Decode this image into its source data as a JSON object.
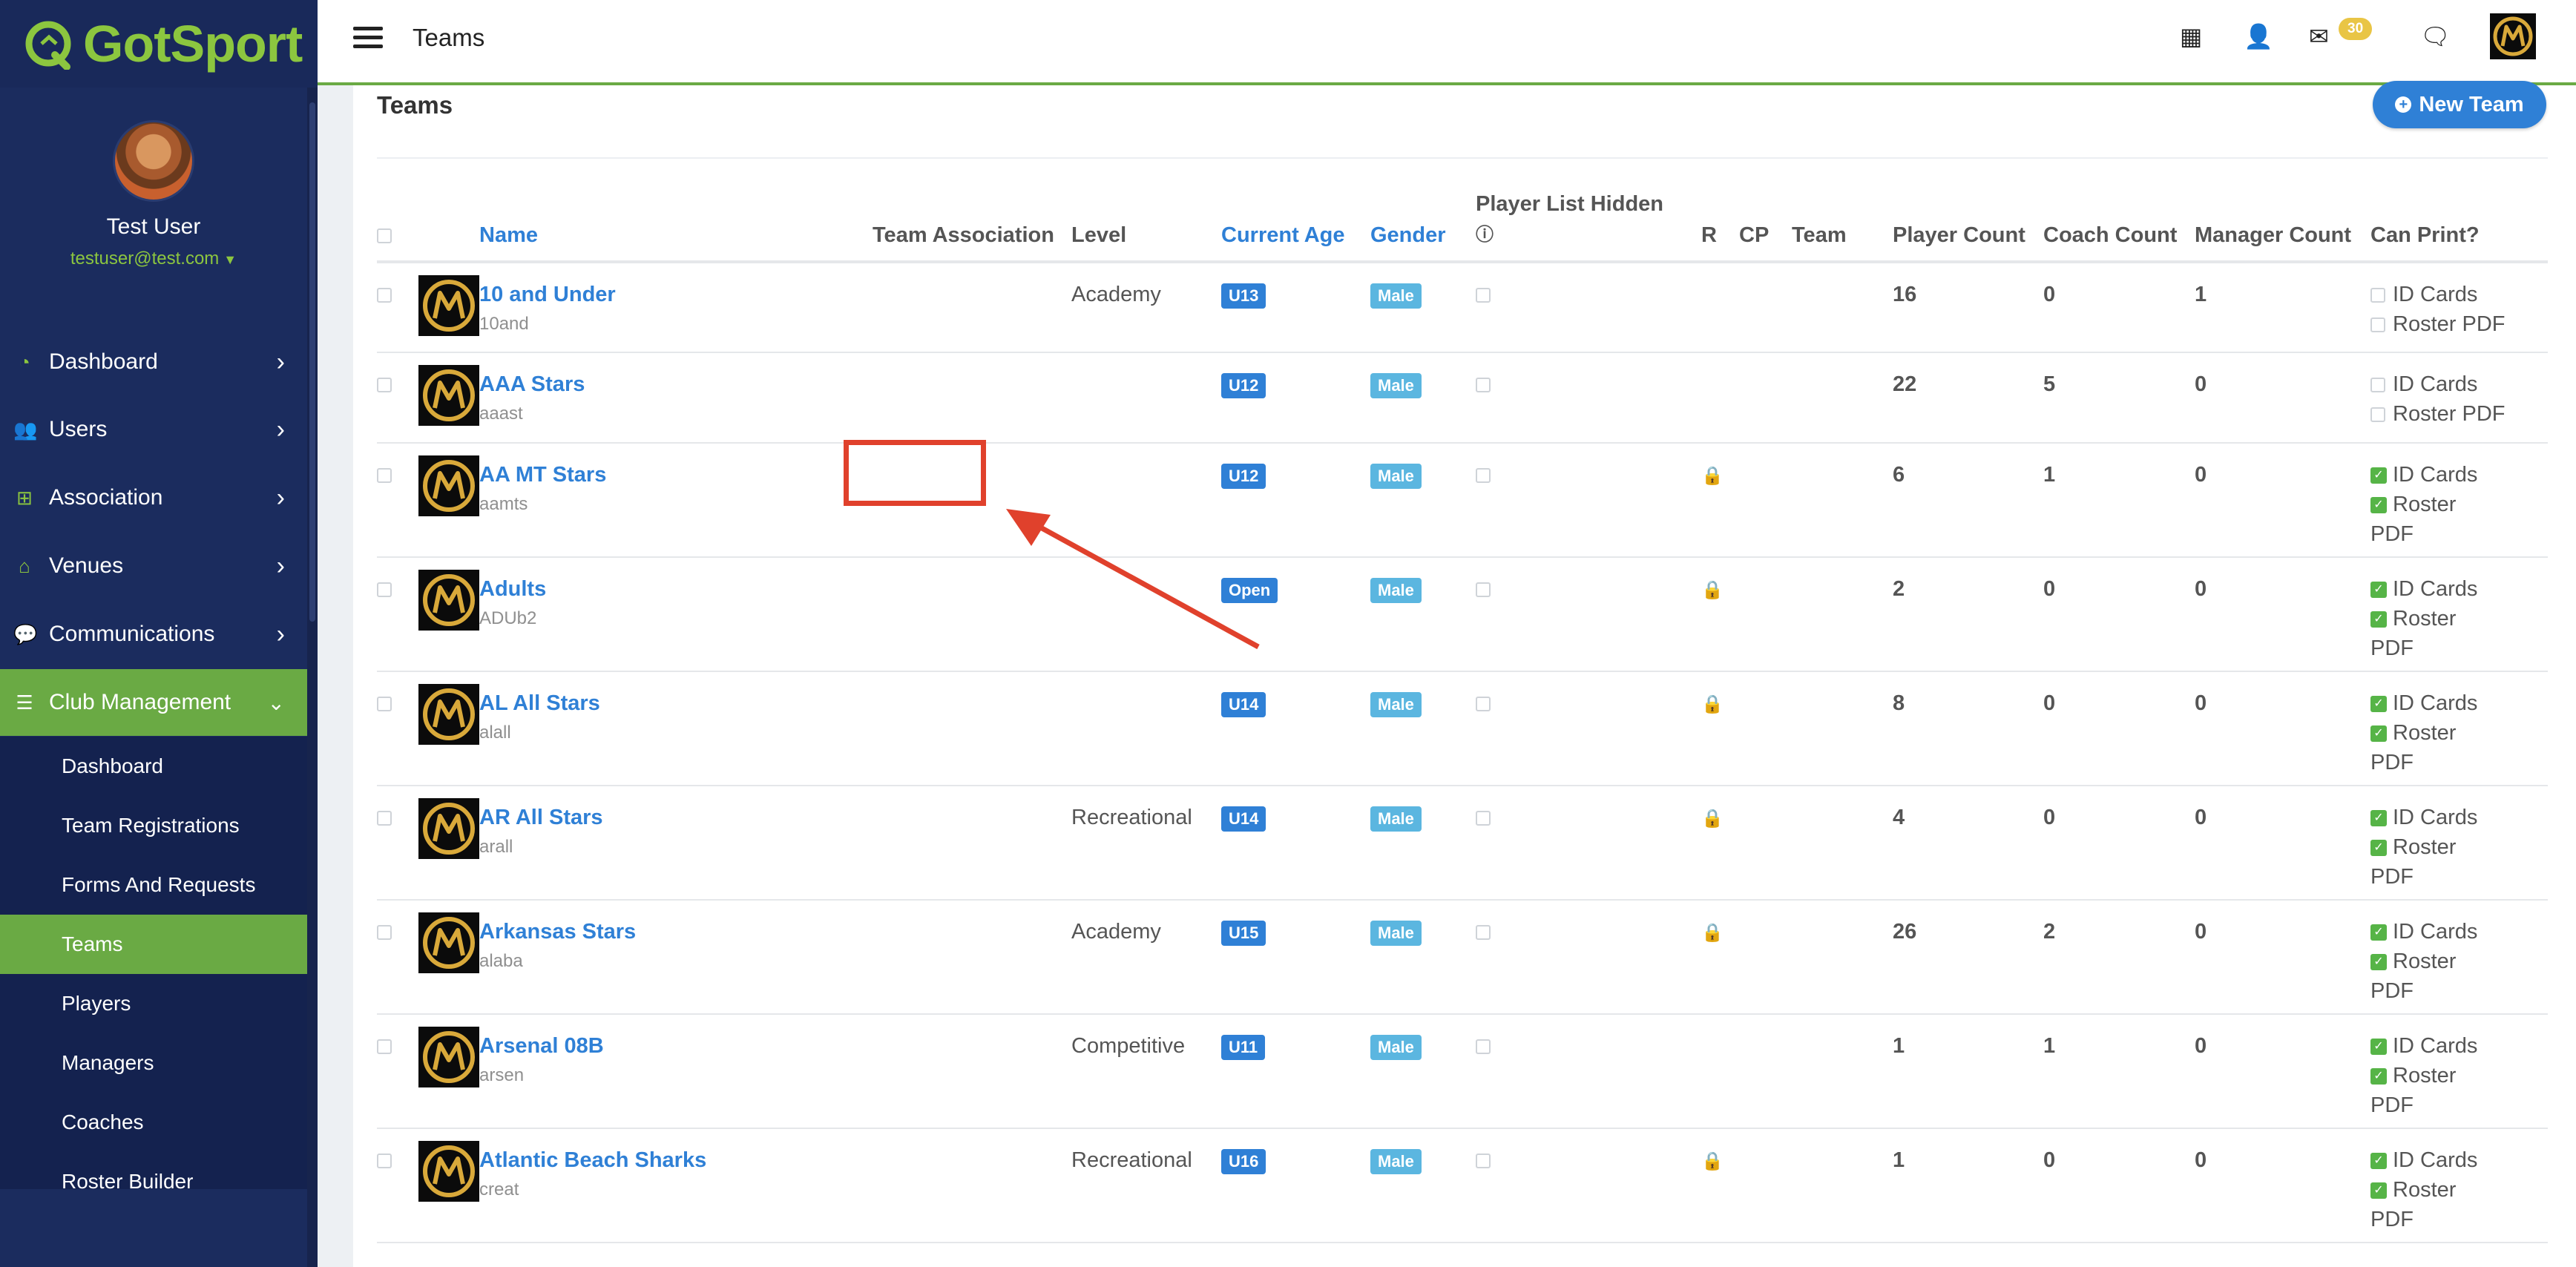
{
  "brand": {
    "name": "GotSport",
    "accent": "#8cc63f"
  },
  "profile": {
    "name": "Test User",
    "email": "testuser@test.com"
  },
  "nav": [
    {
      "label": "Dashboard",
      "icon": "tachometer-icon"
    },
    {
      "label": "Users",
      "icon": "users-icon"
    },
    {
      "label": "Association",
      "icon": "sitemap-icon"
    },
    {
      "label": "Venues",
      "icon": "home-icon"
    },
    {
      "label": "Communications",
      "icon": "comments-icon"
    },
    {
      "label": "Club Management",
      "icon": "list-icon",
      "expanded": true
    }
  ],
  "submenu": [
    "Dashboard",
    "Team Registrations",
    "Forms And Requests",
    "Teams",
    "Players",
    "Managers",
    "Coaches",
    "Roster Builder"
  ],
  "active_submenu": "Teams",
  "topbar": {
    "title": "Teams",
    "mail_count": "30"
  },
  "page": {
    "title": "Teams",
    "new_team_label": "New Team"
  },
  "columns": {
    "name": "Name",
    "team_association": "Team Association",
    "level": "Level",
    "current_age": "Current Age",
    "gender": "Gender",
    "player_list_hidden": "Player List Hidden",
    "r": "R",
    "cp": "CP",
    "team": "Team",
    "player_count": "Player Count",
    "coach_count": "Coach Count",
    "manager_count": "Manager Count",
    "can_print": "Can Print?"
  },
  "print_labels": {
    "id_cards": "ID Cards",
    "roster": "Roster",
    "pdf": "PDF",
    "roster_pdf": "Roster PDF"
  },
  "teams": [
    {
      "name": "10 and Under",
      "code": "10and",
      "level": "Academy",
      "age": "U13",
      "gender": "Male",
      "locked": false,
      "players": "16",
      "coaches": "0",
      "managers": "1",
      "can_print": false
    },
    {
      "name": "AAA Stars",
      "code": "aaast",
      "level": "",
      "age": "U12",
      "gender": "Male",
      "locked": false,
      "players": "22",
      "coaches": "5",
      "managers": "0",
      "can_print": false
    },
    {
      "name": "AA MT Stars",
      "code": "aamts",
      "level": "",
      "age": "U12",
      "gender": "Male",
      "locked": true,
      "players": "6",
      "coaches": "1",
      "managers": "0",
      "can_print": true
    },
    {
      "name": "Adults",
      "code": "ADUb2",
      "level": "",
      "age": "Open",
      "gender": "Male",
      "locked": true,
      "players": "2",
      "coaches": "0",
      "managers": "0",
      "can_print": true
    },
    {
      "name": "AL All Stars",
      "code": "alall",
      "level": "",
      "age": "U14",
      "gender": "Male",
      "locked": true,
      "players": "8",
      "coaches": "0",
      "managers": "0",
      "can_print": true
    },
    {
      "name": "AR All Stars",
      "code": "arall",
      "level": "Recreational",
      "age": "U14",
      "gender": "Male",
      "locked": true,
      "players": "4",
      "coaches": "0",
      "managers": "0",
      "can_print": true
    },
    {
      "name": "Arkansas Stars",
      "code": "alaba",
      "level": "Academy",
      "age": "U15",
      "gender": "Male",
      "locked": true,
      "players": "26",
      "coaches": "2",
      "managers": "0",
      "can_print": true
    },
    {
      "name": "Arsenal 08B",
      "code": "arsen",
      "level": "Competitive",
      "age": "U11",
      "gender": "Male",
      "locked": false,
      "players": "1",
      "coaches": "1",
      "managers": "0",
      "can_print": true
    },
    {
      "name": "Atlantic Beach Sharks",
      "code": "creat",
      "level": "Recreational",
      "age": "U16",
      "gender": "Male",
      "locked": true,
      "players": "1",
      "coaches": "0",
      "managers": "0",
      "can_print": true
    }
  ]
}
